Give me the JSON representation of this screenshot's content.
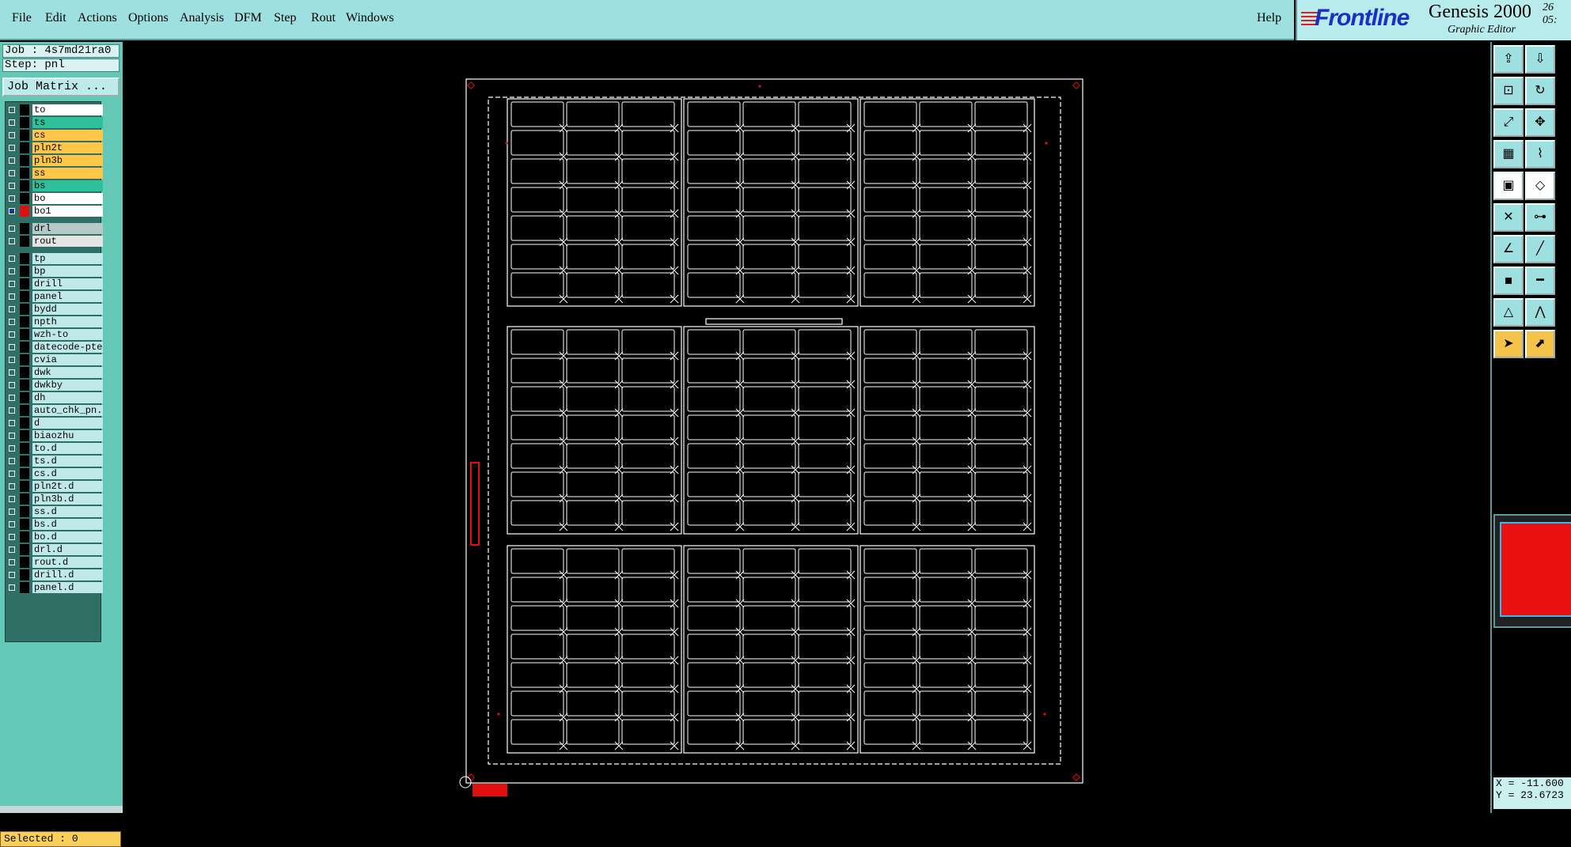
{
  "menubar": {
    "items": [
      "File",
      "Edit",
      "Actions",
      "Options",
      "Analysis",
      "DFM",
      "Step",
      "Rout",
      "Windows"
    ],
    "help": "Help"
  },
  "brand": {
    "logo": "Frontline",
    "product": "Genesis 2000",
    "subtitle": "Graphic Editor",
    "date_partial": "26",
    "time_partial": "05:"
  },
  "job": {
    "job_line": "Job : 4s7md21ra0",
    "step_line": "Step: pnl",
    "matrix_button": "Job Matrix ..."
  },
  "layers": [
    {
      "name": "to",
      "color": "white",
      "active": false
    },
    {
      "name": "ts",
      "color": "teal",
      "active": false
    },
    {
      "name": "cs",
      "color": "orange",
      "active": false
    },
    {
      "name": "pln2t",
      "color": "orange",
      "active": false
    },
    {
      "name": "pln3b",
      "color": "orange",
      "active": false
    },
    {
      "name": "ss",
      "color": "orange",
      "active": false
    },
    {
      "name": "bs",
      "color": "teal",
      "active": false
    },
    {
      "name": "bo",
      "color": "white",
      "active": false
    },
    {
      "name": "bo1",
      "color": "white",
      "active": true
    },
    {
      "name": "drl",
      "color": "gray",
      "active": false
    },
    {
      "name": "rout",
      "color": "light",
      "active": false
    },
    {
      "name": "tp",
      "color": "cyan",
      "active": false
    },
    {
      "name": "bp",
      "color": "cyan",
      "active": false
    },
    {
      "name": "drill",
      "color": "cyan",
      "active": false
    },
    {
      "name": "panel",
      "color": "cyan",
      "active": false
    },
    {
      "name": "bydd",
      "color": "cyan",
      "active": false
    },
    {
      "name": "npth",
      "color": "cyan",
      "active": false
    },
    {
      "name": "wzh-to",
      "color": "cyan",
      "active": false
    },
    {
      "name": "datecode-pte",
      "color": "cyan",
      "active": false
    },
    {
      "name": "cvia",
      "color": "cyan",
      "active": false
    },
    {
      "name": "dwk",
      "color": "cyan",
      "active": false
    },
    {
      "name": "dwkby",
      "color": "cyan",
      "active": false
    },
    {
      "name": "dh",
      "color": "cyan",
      "active": false
    },
    {
      "name": "auto_chk_pn.",
      "color": "cyan",
      "active": false
    },
    {
      "name": "d",
      "color": "cyan",
      "active": false
    },
    {
      "name": "biaozhu",
      "color": "cyan",
      "active": false
    },
    {
      "name": "to.d",
      "color": "cyan",
      "active": false
    },
    {
      "name": "ts.d",
      "color": "cyan",
      "active": false
    },
    {
      "name": "cs.d",
      "color": "cyan",
      "active": false
    },
    {
      "name": "pln2t.d",
      "color": "cyan",
      "active": false
    },
    {
      "name": "pln3b.d",
      "color": "cyan",
      "active": false
    },
    {
      "name": "ss.d",
      "color": "cyan",
      "active": false
    },
    {
      "name": "bs.d",
      "color": "cyan",
      "active": false
    },
    {
      "name": "bo.d",
      "color": "cyan",
      "active": false
    },
    {
      "name": "drl.d",
      "color": "cyan",
      "active": false
    },
    {
      "name": "rout.d",
      "color": "cyan",
      "active": false
    },
    {
      "name": "drill.d",
      "color": "cyan",
      "active": false
    },
    {
      "name": "panel.d",
      "color": "cyan",
      "active": false
    }
  ],
  "status": {
    "selected": "Selected : 0"
  },
  "coords": {
    "x": "X = -11.600",
    "y": "Y = 23.6723"
  },
  "tools": [
    "upload-icon",
    "download-icon",
    "zoom-frame-icon",
    "refresh-icon",
    "fit-icon",
    "center-icon",
    "grid-icon",
    "route-icon",
    "select-box-icon",
    "edit-poly-icon",
    "cross-icon",
    "connect-icon",
    "line-red-icon",
    "line-blue-icon",
    "pad-icon",
    "dash-icon",
    "triangle-icon",
    "angle-icon",
    "pointer-icon",
    "pointer-select-icon"
  ],
  "colors": {
    "menubar": "#9edfdf",
    "panel": "#63c9b6",
    "canvas": "#000000",
    "board_lines": "#ffffff",
    "accent_red": "#e01010"
  }
}
